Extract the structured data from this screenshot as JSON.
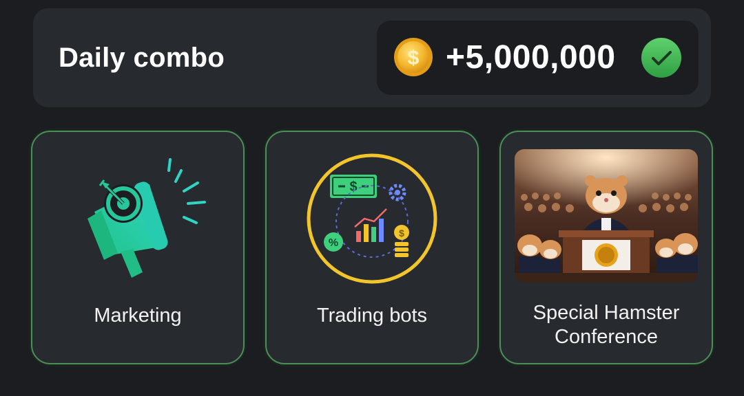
{
  "header": {
    "title": "Daily combo",
    "reward_amount": "+5,000,000",
    "coin_icon": "coin-icon",
    "status_icon": "checkmark-icon"
  },
  "cards": [
    {
      "label": "Marketing",
      "icon": "megaphone-target-icon"
    },
    {
      "label": "Trading bots",
      "icon": "trading-bots-icon"
    },
    {
      "label_line1": "Special Hamster",
      "label_line2": "Conference",
      "icon": "hamster-conference-image"
    }
  ],
  "colors": {
    "background": "#1b1d21",
    "panel": "#272a2f",
    "card_border": "#4b8f56",
    "coin": "#f5b82e",
    "check": "#3cb554"
  }
}
